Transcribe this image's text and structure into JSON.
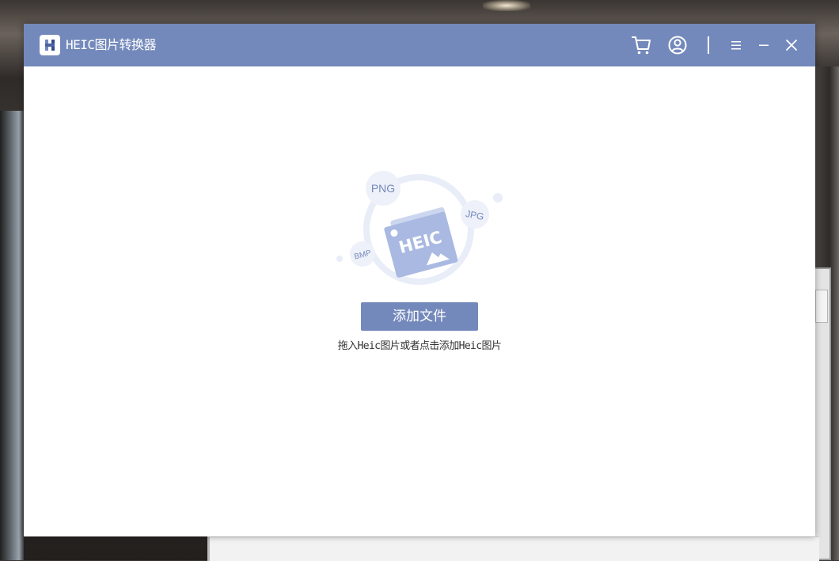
{
  "window": {
    "title": "HEIC图片转换器",
    "logo_letter": "H"
  },
  "toolbar": {
    "cart_icon": "cart-icon",
    "account_icon": "user-circle-icon",
    "menu_icon": "hamburger-menu-icon",
    "minimize_icon": "minimize-icon",
    "close_icon": "close-icon"
  },
  "illustration": {
    "main_label": "HEIC",
    "badges": [
      "PNG",
      "JPG",
      "BMP"
    ]
  },
  "main": {
    "add_button_label": "添加文件",
    "hint_text": "拖入Heic图片或者点击添加Heic图片"
  },
  "colors": {
    "accent": "#7489bb",
    "illustration_light": "#e8edf8",
    "illustration_mid": "#a9b9e2"
  }
}
